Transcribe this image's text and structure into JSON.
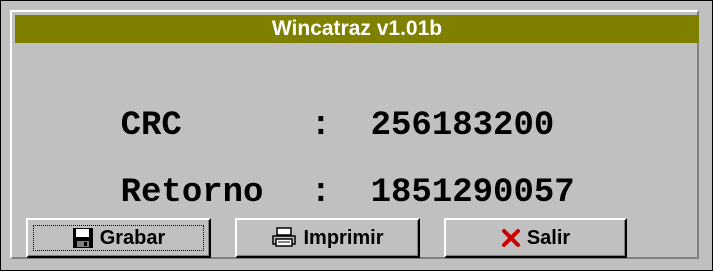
{
  "window": {
    "title": "Wincatraz v1.01b"
  },
  "rows": [
    {
      "label": "CRC",
      "separator": ":",
      "value": "256183200"
    },
    {
      "label": "Retorno",
      "separator": ":",
      "value": "1851290057"
    }
  ],
  "buttons": {
    "save": {
      "label": "Grabar",
      "icon": "floppy-disk-icon"
    },
    "print": {
      "label": "Imprimir",
      "icon": "printer-icon"
    },
    "exit": {
      "label": "Salir",
      "icon": "close-x-icon",
      "icon_color": "#cc0000"
    }
  },
  "colors": {
    "titlebar": "#808000",
    "face": "#c0c0c0"
  }
}
